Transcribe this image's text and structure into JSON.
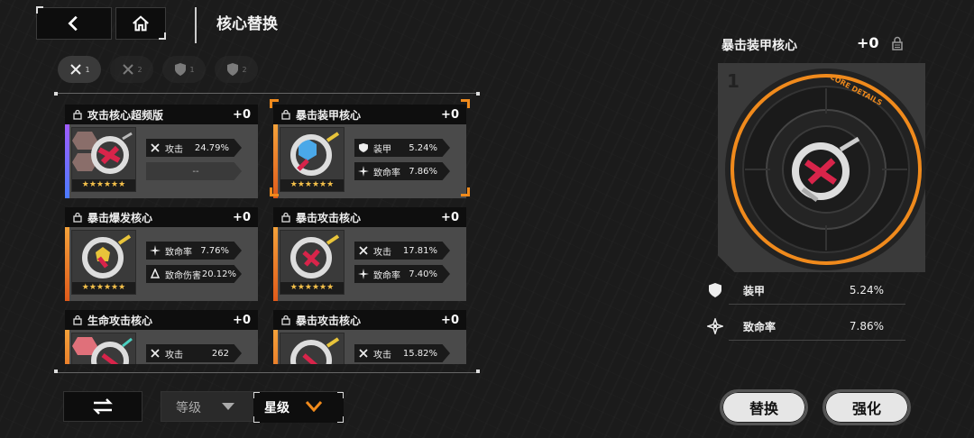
{
  "header": {
    "title": "核心替换"
  },
  "filters": [
    {
      "count": "1",
      "icon": "crossed-swords-icon",
      "state": "active"
    },
    {
      "count": "2",
      "icon": "crossed-swords-icon",
      "state": "dim"
    },
    {
      "count": "1",
      "icon": "shield-icon",
      "state": "dim"
    },
    {
      "count": "2",
      "icon": "shield-icon",
      "state": "dim"
    }
  ],
  "cards": [
    {
      "name": "攻击核心超频版",
      "plus": "+0",
      "stars": "★★★★★★",
      "rarity_color": "#7a5cff",
      "stats": [
        {
          "icon": "crossed-swords-icon",
          "name": "攻击",
          "value": "24.79%"
        },
        {
          "empty": "--"
        }
      ]
    },
    {
      "name": "暴击装甲核心",
      "plus": "+0",
      "stars": "★★★★★★",
      "rarity_color": "#f08a1c",
      "selected": true,
      "stats": [
        {
          "icon": "shield-icon",
          "name": "装甲",
          "value": "5.24%"
        },
        {
          "icon": "crit-icon",
          "name": "致命率",
          "value": "7.86%"
        }
      ]
    },
    {
      "name": "暴击爆发核心",
      "plus": "+0",
      "stars": "★★★★★★",
      "rarity_color": "#f08a1c",
      "stats": [
        {
          "icon": "crit-icon",
          "name": "致命率",
          "value": "7.76%"
        },
        {
          "icon": "burst-icon",
          "name": "致命伤害",
          "value": "20.12%"
        }
      ]
    },
    {
      "name": "暴击攻击核心",
      "plus": "+0",
      "stars": "★★★★★★",
      "rarity_color": "#f08a1c",
      "stats": [
        {
          "icon": "crossed-swords-icon",
          "name": "攻击",
          "value": "17.81%"
        },
        {
          "icon": "crit-icon",
          "name": "致命率",
          "value": "7.40%"
        }
      ]
    },
    {
      "name": "生命攻击核心",
      "plus": "+0",
      "stars": "★★★★★★",
      "rarity_color": "#f08a1c",
      "stats": [
        {
          "icon": "crossed-swords-icon",
          "name": "攻击",
          "value": "262"
        }
      ]
    },
    {
      "name": "暴击攻击核心",
      "plus": "+0",
      "stars": "★★★★★★",
      "rarity_color": "#f08a1c",
      "stats": [
        {
          "icon": "crossed-swords-icon",
          "name": "攻击",
          "value": "15.82%"
        }
      ]
    }
  ],
  "sort": {
    "level_label": "等级",
    "star_label": "星级"
  },
  "detail": {
    "name": "暴击装甲核心",
    "plus": "+0",
    "slot_number": "1",
    "badge_text": "CORE DETAILS",
    "stats": [
      {
        "icon": "shield-icon",
        "name": "装甲",
        "value": "5.24%"
      },
      {
        "icon": "crit-icon",
        "name": "致命率",
        "value": "7.86%"
      }
    ]
  },
  "actions": {
    "replace_label": "替换",
    "enhance_label": "强化"
  },
  "colors": {
    "accent": "#f08a1c",
    "background": "#1b1b1b",
    "card": "#4a4a4a"
  }
}
